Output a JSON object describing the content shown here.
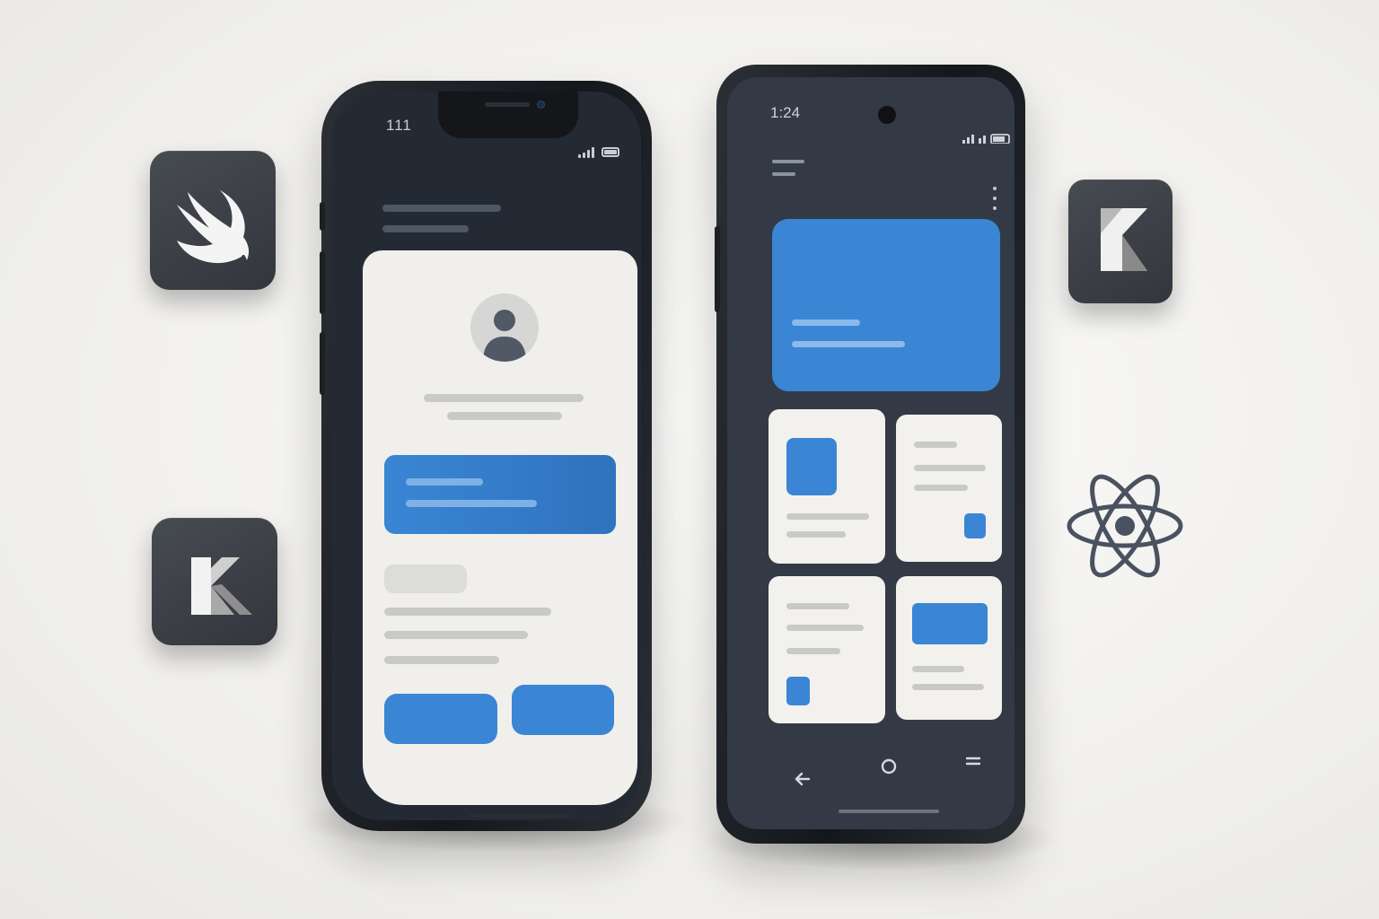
{
  "ios_phone": {
    "status_time": "111"
  },
  "android_phone": {
    "status_time": "1:24"
  },
  "badges": [
    {
      "name": "swift-badge",
      "icon": "swift-icon"
    },
    {
      "name": "kotlin-badge",
      "icon": "kotlin-icon"
    },
    {
      "name": "kotlin-badge",
      "icon": "kotlin-icon"
    },
    {
      "name": "react-logo",
      "icon": "react-icon"
    }
  ],
  "colors": {
    "accent": "#3a86d4",
    "phone_frame": "#1a1d22",
    "ios_screen": "#242a33",
    "android_screen": "#333a45",
    "card": "#f0efec",
    "placeholder": "#c9c9c8"
  }
}
